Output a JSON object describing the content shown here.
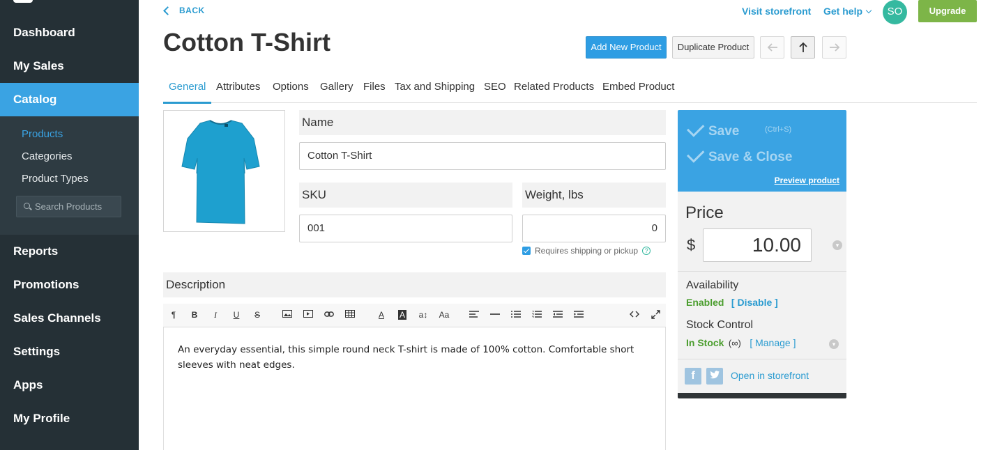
{
  "sidebar": {
    "nav": [
      "Dashboard",
      "My Sales",
      "Catalog",
      "Reports",
      "Promotions",
      "Sales Channels",
      "Settings",
      "Apps",
      "My Profile"
    ],
    "subnav": [
      "Products",
      "Categories",
      "Product Types"
    ],
    "search_placeholder": "Search Products"
  },
  "header": {
    "back": "BACK",
    "visit_storefront": "Visit storefront",
    "get_help": "Get help",
    "avatar_initials": "SO",
    "upgrade": "Upgrade",
    "title": "Cotton T-Shirt",
    "add_new_product": "Add New Product",
    "duplicate_product": "Duplicate Product"
  },
  "tabs": [
    "General",
    "Attributes",
    "Options",
    "Gallery",
    "Files",
    "Tax and Shipping",
    "SEO",
    "Related Products",
    "Embed Product"
  ],
  "form": {
    "name_label": "Name",
    "name_value": "Cotton T-Shirt",
    "sku_label": "SKU",
    "sku_value": "001",
    "weight_label": "Weight, lbs",
    "weight_value": "0",
    "requires_shipping": "Requires shipping or pickup",
    "description_label": "Description",
    "description_text": "An everyday essential, this simple round neck T-shirt is made of 100% cotton. Comfortable short sleeves with neat edges."
  },
  "panel": {
    "save": "Save",
    "save_shortcut": "(Ctrl+S)",
    "save_close": "Save & Close",
    "preview": "Preview product",
    "price_label": "Price",
    "currency": "$",
    "price_value": "10.00",
    "availability_label": "Availability",
    "availability_status": "Enabled",
    "disable_link": "[ Disable ]",
    "stock_label": "Stock Control",
    "stock_status": "In Stock",
    "stock_infinity": "(∞)",
    "manage_link": "[ Manage ]",
    "open_storefront": "Open in storefront"
  },
  "colors": {
    "sidebar_bg": "#253036",
    "accent": "#3aa3e3",
    "link": "#2a9bd0",
    "upgrade": "#7db548",
    "success": "#4a9d2d",
    "tshirt": "#1ea0cf"
  }
}
